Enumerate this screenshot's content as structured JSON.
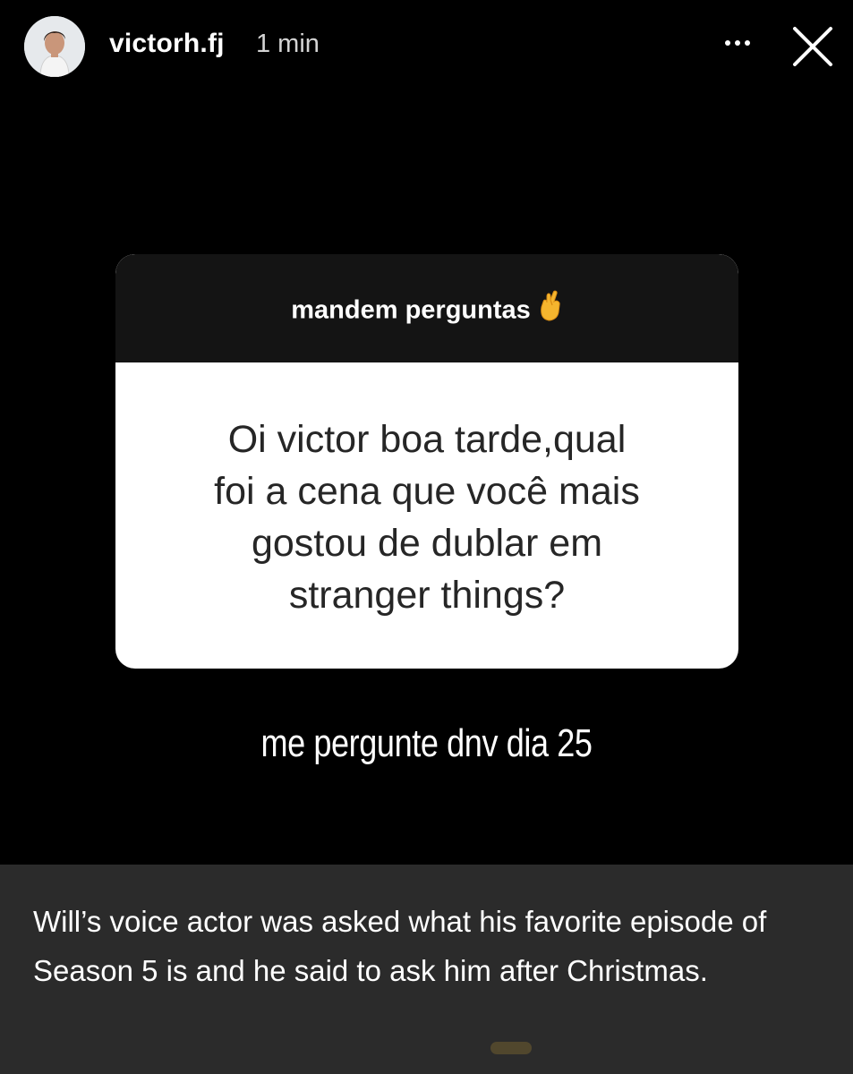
{
  "story": {
    "username": "victorh.fj",
    "time": "1 min",
    "icons": {
      "avatar": "profile-avatar",
      "more": "more-dots-icon",
      "close": "close-icon"
    },
    "question_box": {
      "title": "mandem perguntas",
      "title_emoji": "crossed-fingers-emoji",
      "question": "Oi victor boa tarde,qual foi a cena que você mais gostou de dublar em stranger things?"
    },
    "answer": "me pergunte dnv dia 25"
  },
  "caption": {
    "text": "Will’s voice actor was asked what his favorite episode of Season 5 is and he said to ask him after Christmas."
  },
  "colors": {
    "background": "#000000",
    "caption_panel": "#2b2b2b",
    "question_card": "#ffffff",
    "question_header": "#141414",
    "question_text": "#262626"
  }
}
